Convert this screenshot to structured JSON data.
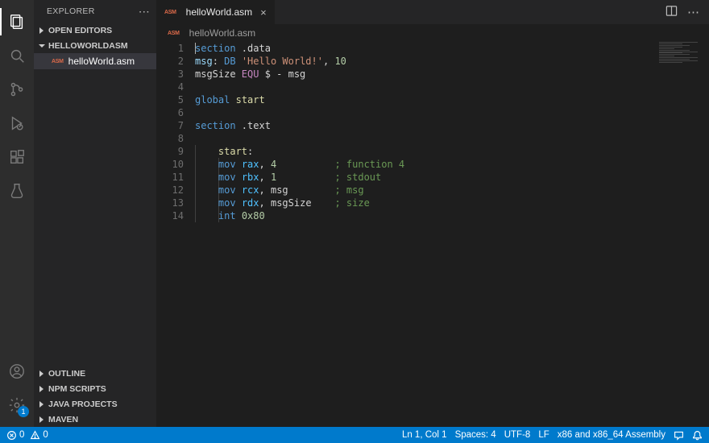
{
  "sidebar": {
    "title": "EXPLORER",
    "sections": {
      "open_editors": "OPEN EDITORS",
      "project": "HELLOWORLDASM",
      "outline": "OUTLINE",
      "npm": "NPM SCRIPTS",
      "java": "JAVA PROJECTS",
      "maven": "MAVEN"
    },
    "files": {
      "f0": {
        "name": "helloWorld.asm",
        "chip": "ASM"
      }
    }
  },
  "tabs": {
    "t0": {
      "name": "helloWorld.asm",
      "chip": "ASM"
    }
  },
  "breadcrumb": {
    "file": "helloWorld.asm",
    "chip": "ASM"
  },
  "activity": {
    "settings_badge": "1"
  },
  "code": {
    "l1": {
      "a": "section",
      "b": " .data"
    },
    "l2": {
      "a": "msg",
      "b": ": ",
      "c": "DB",
      "d": " ",
      "e": "'Hello World!'",
      "f": ", ",
      "g": "10"
    },
    "l3": {
      "a": "msgSize ",
      "b": "EQU",
      "c": " $ - msg"
    },
    "l5": {
      "a": "global",
      "b": " ",
      "c": "start"
    },
    "l7": {
      "a": "section",
      "b": " .text"
    },
    "l9": {
      "a": "start",
      "b": ":"
    },
    "l10": {
      "a": "mov",
      "b": " ",
      "c": "rax",
      "d": ", ",
      "e": "4",
      "pad": "          ",
      "cmt": "; function 4"
    },
    "l11": {
      "a": "mov",
      "b": " ",
      "c": "rbx",
      "d": ", ",
      "e": "1",
      "pad": "          ",
      "cmt": "; stdout"
    },
    "l12": {
      "a": "mov",
      "b": " ",
      "c": "rcx",
      "d": ", ",
      "e": "msg",
      "pad": "        ",
      "cmt": "; msg"
    },
    "l13": {
      "a": "mov",
      "b": " ",
      "c": "rdx",
      "d": ", ",
      "e": "msgSize",
      "pad": "    ",
      "cmt": "; size"
    },
    "l14": {
      "a": "int",
      "b": " ",
      "c": "0x80"
    }
  },
  "line_numbers": [
    "1",
    "2",
    "3",
    "4",
    "5",
    "6",
    "7",
    "8",
    "9",
    "10",
    "11",
    "12",
    "13",
    "14"
  ],
  "status": {
    "errors": "0",
    "warnings": "0",
    "cursor": "Ln 1, Col 1",
    "spaces": "Spaces: 4",
    "encoding": "UTF-8",
    "eol": "LF",
    "language": "x86 and x86_64 Assembly"
  }
}
